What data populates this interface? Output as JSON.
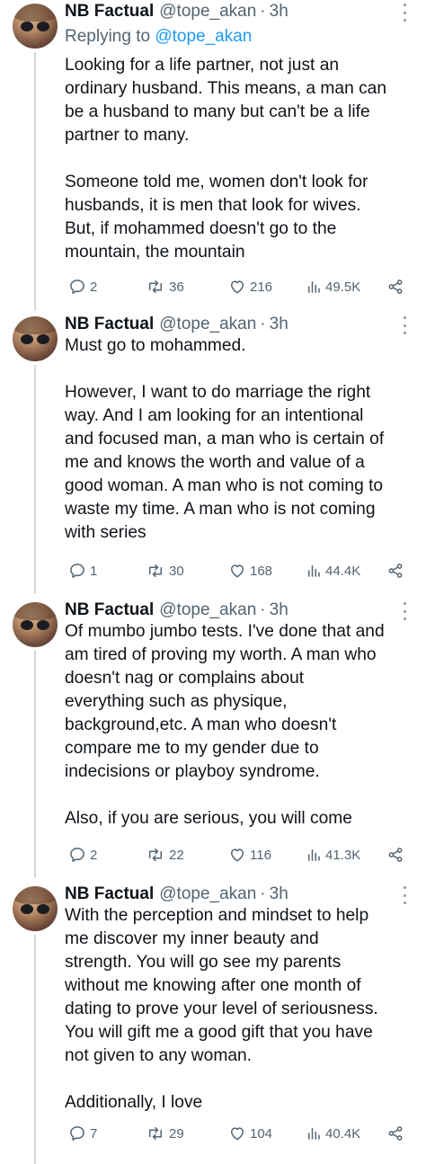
{
  "tweets": [
    {
      "name": "NB Factual",
      "handle": "@tope_akan",
      "sep": "·",
      "time": "3h",
      "replying_prefix": "Replying to ",
      "replying_to": "@tope_akan",
      "text": "Looking for a life partner, not just an\nordinary husband. This means, a man can\nbe a husband to many but can't be a life\npartner to many.\n\nSomeone told me, women don't look for\nhusbands, it is men that look for wives.\nBut, if mohammed doesn't go to the\nmountain, the mountain",
      "replies": "2",
      "retweets": "36",
      "likes": "216",
      "views": "49.5K"
    },
    {
      "name": "NB Factual",
      "handle": "@tope_akan",
      "sep": "·",
      "time": "3h",
      "text": "Must go to mohammed.\n\nHowever, I want to do marriage the right\nway. And I am looking for an intentional\nand focused man, a man who is certain of\nme and knows the worth and value of a\ngood woman. A man who is not coming to\nwaste my time. A man who is not coming\nwith series",
      "replies": "1",
      "retweets": "30",
      "likes": "168",
      "views": "44.4K"
    },
    {
      "name": "NB Factual",
      "handle": "@tope_akan",
      "sep": "·",
      "time": "3h",
      "text": "Of mumbo jumbo tests. I've done that and\nam tired of proving my worth. A man who\ndoesn't nag or complains about\neverything such as physique,\nbackground,etc. A man who doesn't\ncompare me to my gender due to\nindecisions or playboy syndrome.\n\nAlso, if you are serious, you will come",
      "replies": "2",
      "retweets": "22",
      "likes": "116",
      "views": "41.3K"
    },
    {
      "name": "NB Factual",
      "handle": "@tope_akan",
      "sep": "·",
      "time": "3h",
      "text": "With the perception and mindset to help\nme discover my inner beauty and\nstrength. You will go see my parents\nwithout me knowing after one month of\ndating to prove your level of seriousness.\nYou will gift me a good gift that you have\nnot given to any woman.\n\nAdditionally, I love",
      "replies": "7",
      "retweets": "29",
      "likes": "104",
      "views": "40.4K"
    }
  ]
}
